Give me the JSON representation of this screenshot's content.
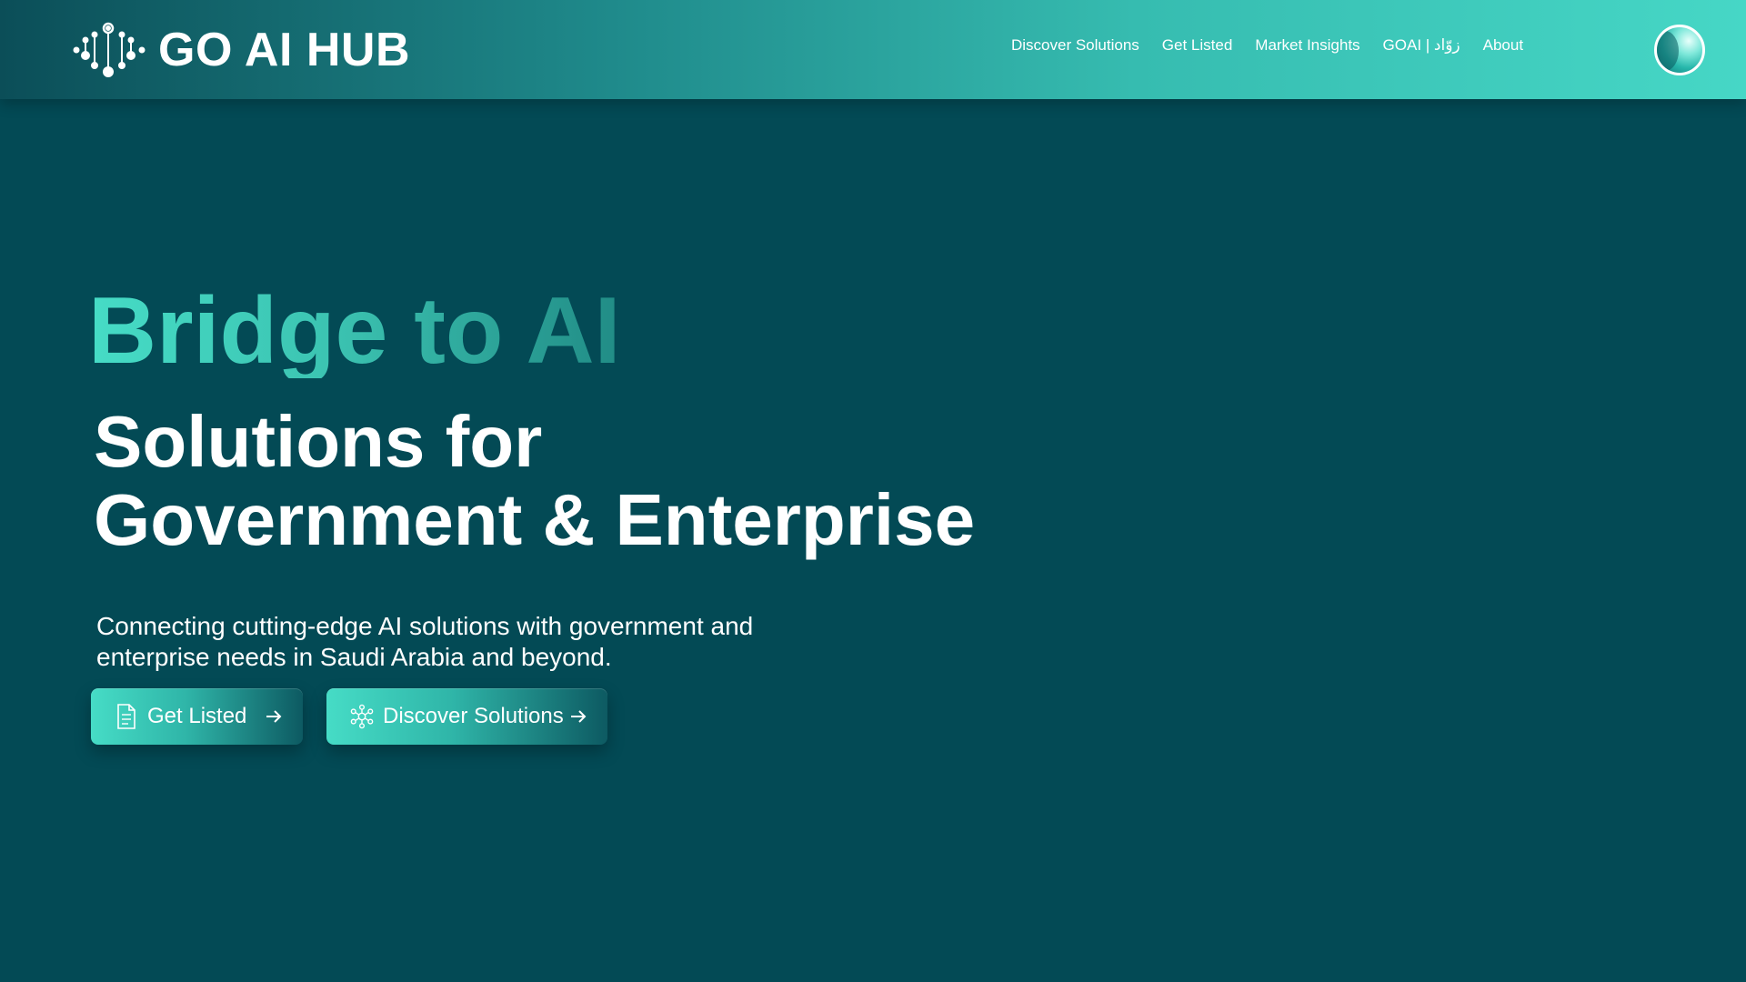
{
  "header": {
    "brand": "GO AI HUB",
    "logo_icon": "circuit-dots-icon",
    "nav": [
      {
        "label": "Discover Solutions"
      },
      {
        "label": "Get Listed"
      },
      {
        "label": "Market Insights"
      },
      {
        "label": "GOAI | زوّاد"
      },
      {
        "label": "About"
      }
    ],
    "avatar_icon": "globe-avatar-icon"
  },
  "hero": {
    "line1": "Bridge to AI",
    "line2": "Solutions for",
    "line3": "Government & Enterprise",
    "subtitle": "Connecting cutting-edge AI solutions with government and enterprise needs in Saudi Arabia and beyond.",
    "buttons": [
      {
        "label": "Get Listed",
        "icon": "document-icon"
      },
      {
        "label": "Discover Solutions",
        "icon": "network-icon"
      }
    ]
  },
  "colors": {
    "background": "#034a55",
    "accent": "#46dcc6",
    "header_start": "#0b4e58",
    "header_end": "#46d7c6"
  }
}
